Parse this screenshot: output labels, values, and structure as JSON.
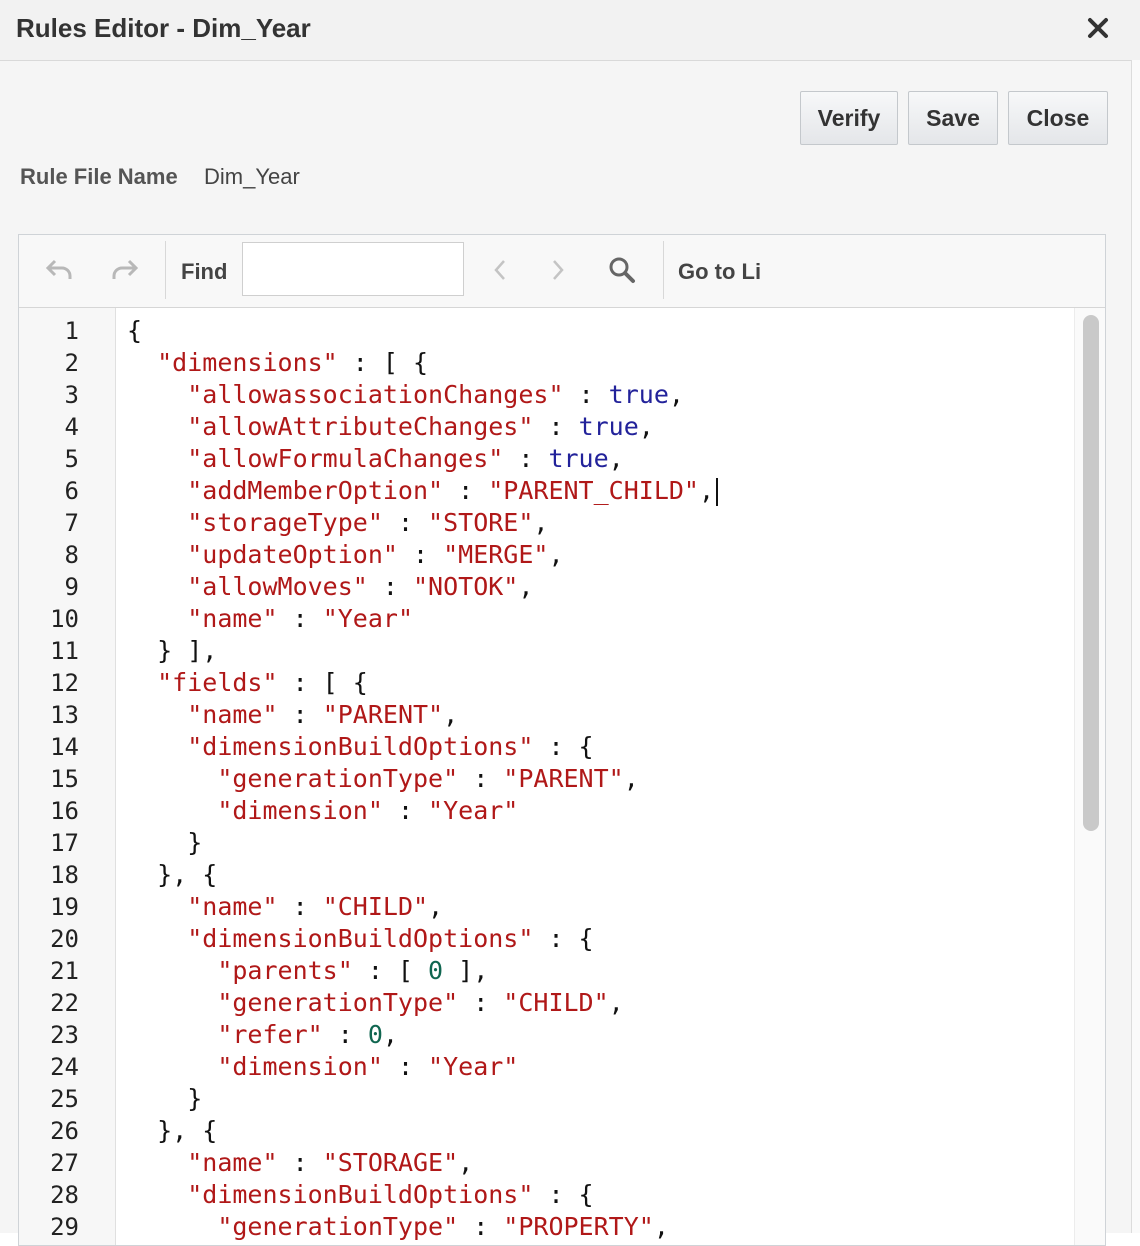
{
  "dialog": {
    "title": "Rules Editor - Dim_Year",
    "close_icon": "close-icon"
  },
  "actions": {
    "verify_label": "Verify",
    "save_label": "Save",
    "close_label": "Close"
  },
  "rule_file": {
    "label": "Rule File Name",
    "value": "Dim_Year"
  },
  "toolbar": {
    "undo_icon": "undo-icon",
    "redo_icon": "redo-icon",
    "find_label": "Find",
    "find_value": "",
    "prev_icon": "chevron-left-icon",
    "next_icon": "chevron-right-icon",
    "search_icon": "search-icon",
    "goto_label": "Go to Li"
  },
  "editor": {
    "colors": {
      "string": "#b01818",
      "keyword": "#22229a",
      "number": "#106650"
    },
    "lines": [
      [
        [
          "p",
          "{"
        ]
      ],
      [
        [
          "p",
          "  "
        ],
        [
          "s",
          "\"dimensions\""
        ],
        [
          "p",
          " : [ {"
        ]
      ],
      [
        [
          "p",
          "    "
        ],
        [
          "s",
          "\"allowassociationChanges\""
        ],
        [
          "p",
          " : "
        ],
        [
          "k",
          "true"
        ],
        [
          "p",
          ","
        ]
      ],
      [
        [
          "p",
          "    "
        ],
        [
          "s",
          "\"allowAttributeChanges\""
        ],
        [
          "p",
          " : "
        ],
        [
          "k",
          "true"
        ],
        [
          "p",
          ","
        ]
      ],
      [
        [
          "p",
          "    "
        ],
        [
          "s",
          "\"allowFormulaChanges\""
        ],
        [
          "p",
          " : "
        ],
        [
          "k",
          "true"
        ],
        [
          "p",
          ","
        ]
      ],
      [
        [
          "p",
          "    "
        ],
        [
          "s",
          "\"addMemberOption\""
        ],
        [
          "p",
          " : "
        ],
        [
          "s",
          "\"PARENT_CHILD\""
        ],
        [
          "p",
          ","
        ]
      ],
      [
        [
          "p",
          "    "
        ],
        [
          "s",
          "\"storageType\""
        ],
        [
          "p",
          " : "
        ],
        [
          "s",
          "\"STORE\""
        ],
        [
          "p",
          ","
        ]
      ],
      [
        [
          "p",
          "    "
        ],
        [
          "s",
          "\"updateOption\""
        ],
        [
          "p",
          " : "
        ],
        [
          "s",
          "\"MERGE\""
        ],
        [
          "p",
          ","
        ]
      ],
      [
        [
          "p",
          "    "
        ],
        [
          "s",
          "\"allowMoves\""
        ],
        [
          "p",
          " : "
        ],
        [
          "s",
          "\"NOTOK\""
        ],
        [
          "p",
          ","
        ]
      ],
      [
        [
          "p",
          "    "
        ],
        [
          "s",
          "\"name\""
        ],
        [
          "p",
          " : "
        ],
        [
          "s",
          "\"Year\""
        ]
      ],
      [
        [
          "p",
          "  } ],"
        ]
      ],
      [
        [
          "p",
          "  "
        ],
        [
          "s",
          "\"fields\""
        ],
        [
          "p",
          " : [ {"
        ]
      ],
      [
        [
          "p",
          "    "
        ],
        [
          "s",
          "\"name\""
        ],
        [
          "p",
          " : "
        ],
        [
          "s",
          "\"PARENT\""
        ],
        [
          "p",
          ","
        ]
      ],
      [
        [
          "p",
          "    "
        ],
        [
          "s",
          "\"dimensionBuildOptions\""
        ],
        [
          "p",
          " : {"
        ]
      ],
      [
        [
          "p",
          "      "
        ],
        [
          "s",
          "\"generationType\""
        ],
        [
          "p",
          " : "
        ],
        [
          "s",
          "\"PARENT\""
        ],
        [
          "p",
          ","
        ]
      ],
      [
        [
          "p",
          "      "
        ],
        [
          "s",
          "\"dimension\""
        ],
        [
          "p",
          " : "
        ],
        [
          "s",
          "\"Year\""
        ]
      ],
      [
        [
          "p",
          "    }"
        ]
      ],
      [
        [
          "p",
          "  }, {"
        ]
      ],
      [
        [
          "p",
          "    "
        ],
        [
          "s",
          "\"name\""
        ],
        [
          "p",
          " : "
        ],
        [
          "s",
          "\"CHILD\""
        ],
        [
          "p",
          ","
        ]
      ],
      [
        [
          "p",
          "    "
        ],
        [
          "s",
          "\"dimensionBuildOptions\""
        ],
        [
          "p",
          " : {"
        ]
      ],
      [
        [
          "p",
          "      "
        ],
        [
          "s",
          "\"parents\""
        ],
        [
          "p",
          " : [ "
        ],
        [
          "n",
          "0"
        ],
        [
          "p",
          " ],"
        ]
      ],
      [
        [
          "p",
          "      "
        ],
        [
          "s",
          "\"generationType\""
        ],
        [
          "p",
          " : "
        ],
        [
          "s",
          "\"CHILD\""
        ],
        [
          "p",
          ","
        ]
      ],
      [
        [
          "p",
          "      "
        ],
        [
          "s",
          "\"refer\""
        ],
        [
          "p",
          " : "
        ],
        [
          "n",
          "0"
        ],
        [
          "p",
          ","
        ]
      ],
      [
        [
          "p",
          "      "
        ],
        [
          "s",
          "\"dimension\""
        ],
        [
          "p",
          " : "
        ],
        [
          "s",
          "\"Year\""
        ]
      ],
      [
        [
          "p",
          "    }"
        ]
      ],
      [
        [
          "p",
          "  }, {"
        ]
      ],
      [
        [
          "p",
          "    "
        ],
        [
          "s",
          "\"name\""
        ],
        [
          "p",
          " : "
        ],
        [
          "s",
          "\"STORAGE\""
        ],
        [
          "p",
          ","
        ]
      ],
      [
        [
          "p",
          "    "
        ],
        [
          "s",
          "\"dimensionBuildOptions\""
        ],
        [
          "p",
          " : {"
        ]
      ],
      [
        [
          "p",
          "      "
        ],
        [
          "s",
          "\"generationType\""
        ],
        [
          "p",
          " : "
        ],
        [
          "s",
          "\"PROPERTY\""
        ],
        [
          "p",
          ","
        ]
      ]
    ],
    "cursor_line": 6
  }
}
